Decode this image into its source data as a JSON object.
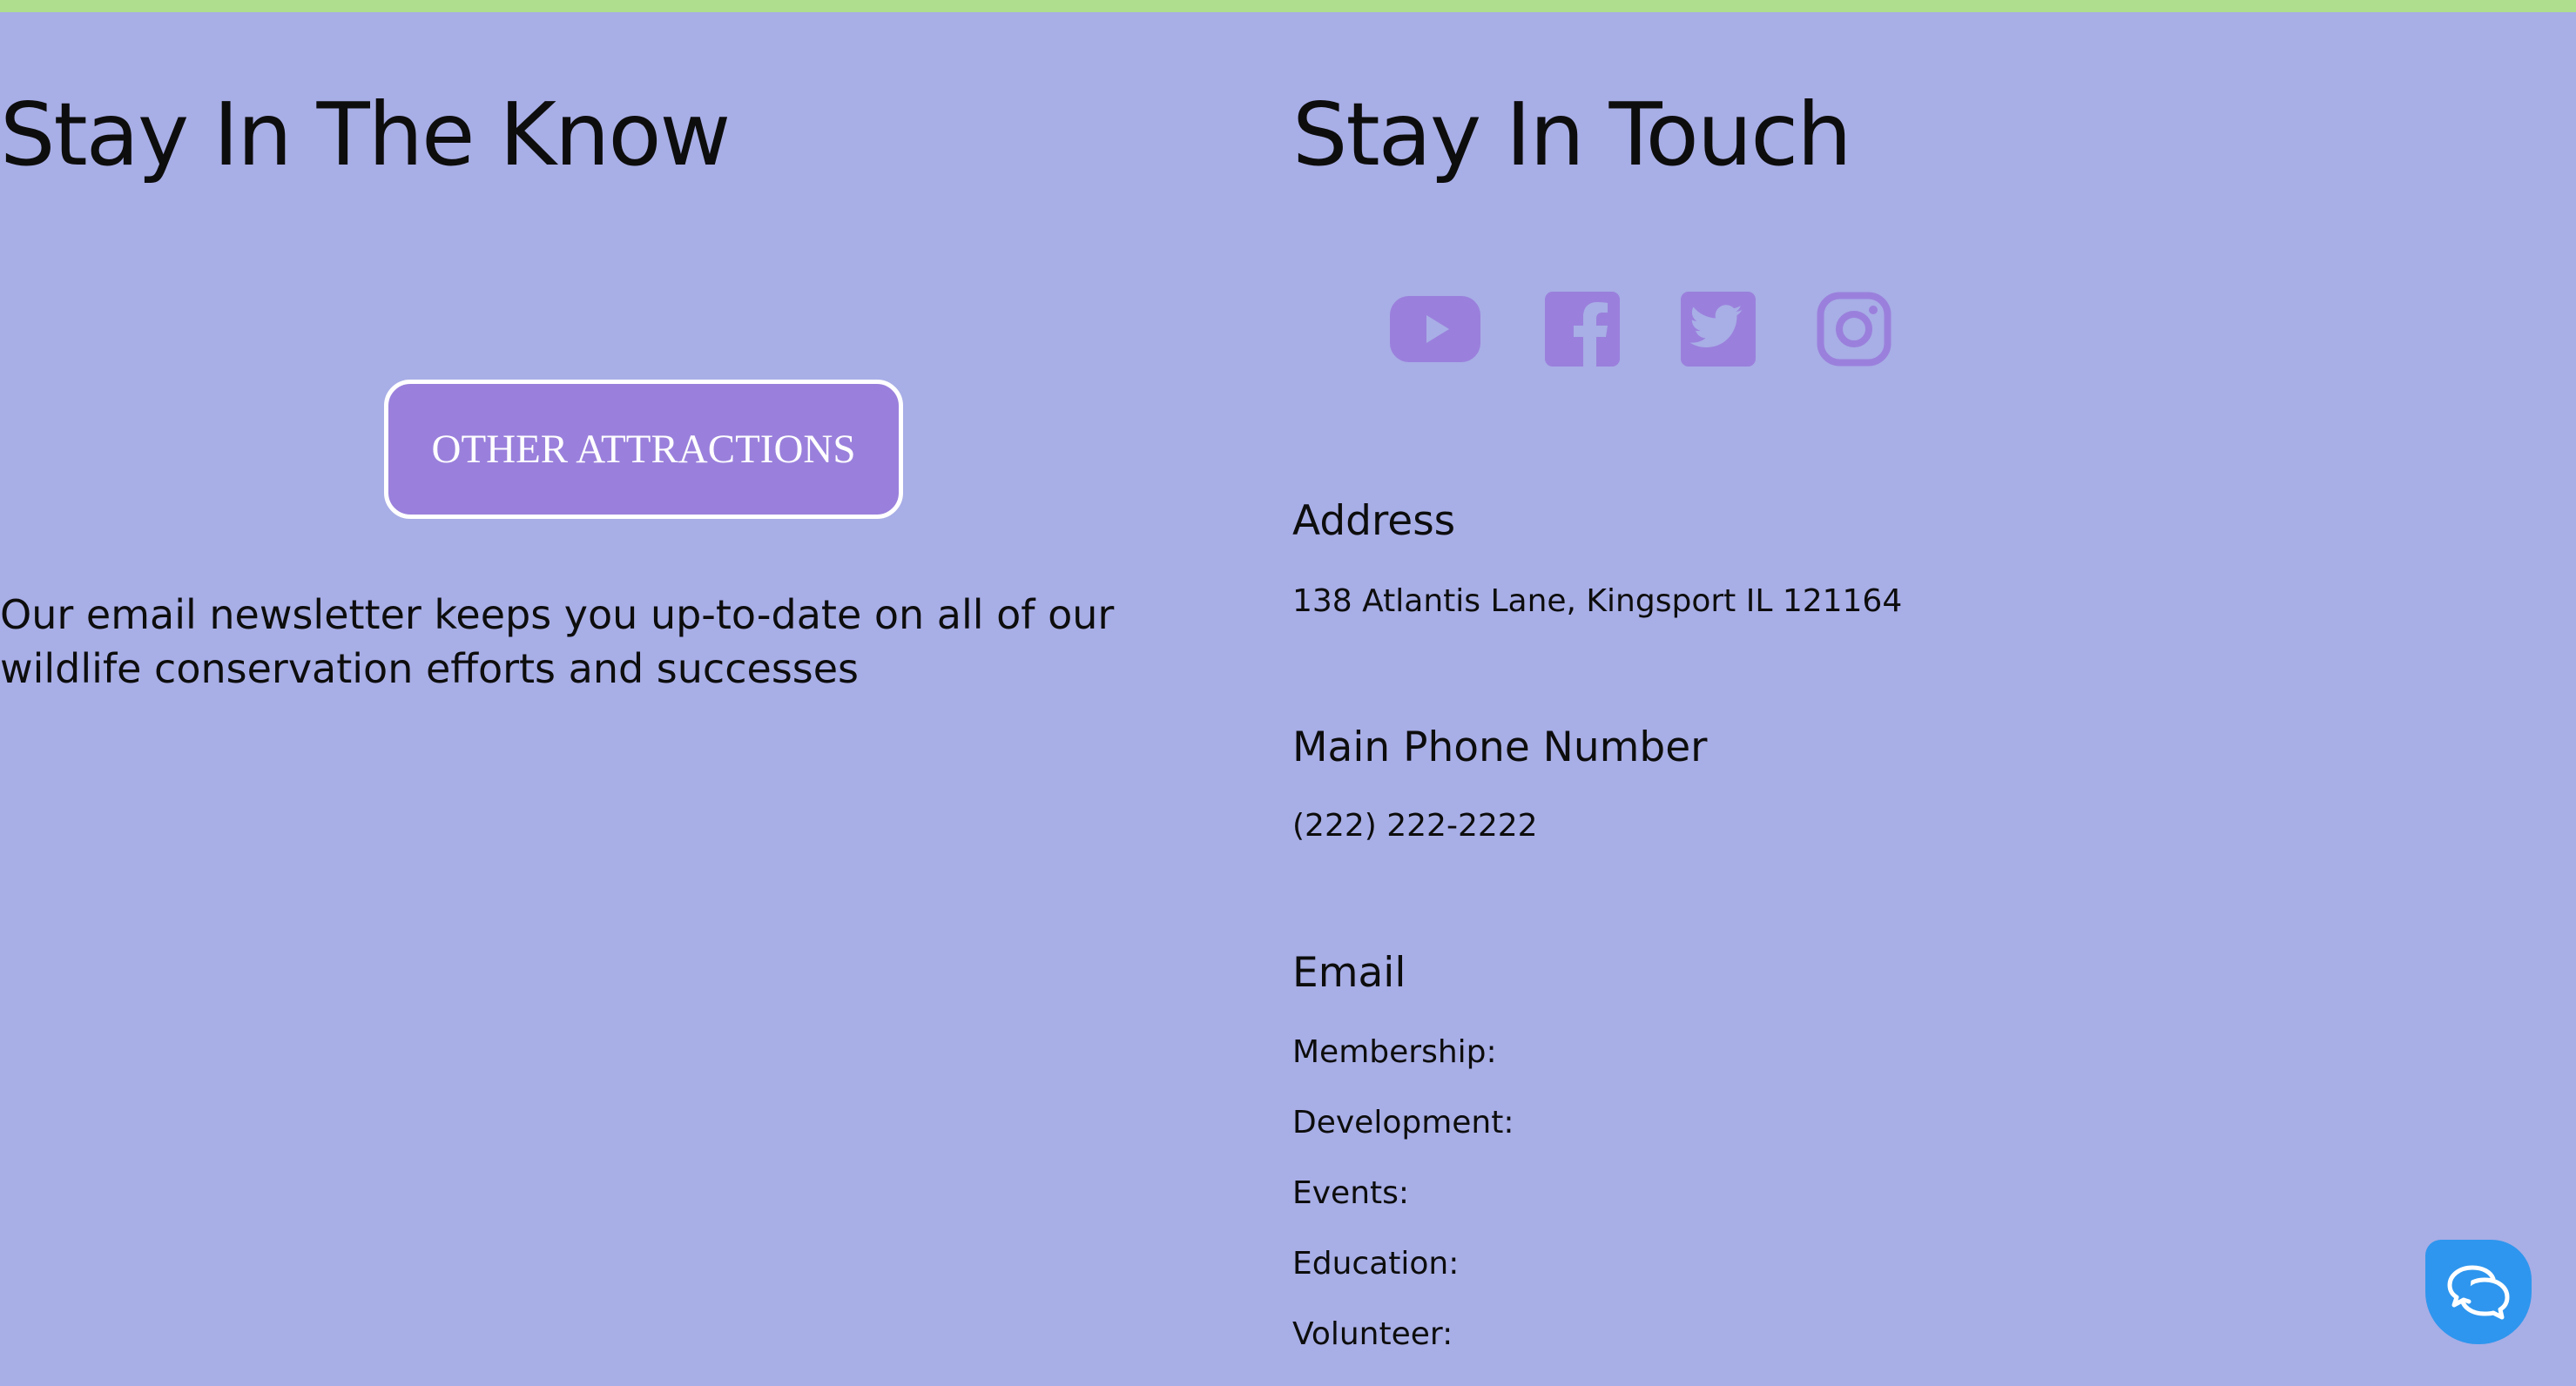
{
  "colors": {
    "background": "#a8aee6",
    "top_bar": "#aede8e",
    "accent_purple": "#9a80dc",
    "chat_blue": "#2e96ee",
    "text": "#0d0d0d"
  },
  "left": {
    "title": "Stay In The Know",
    "button_label": "OTHER ATTRACTIONS",
    "newsletter_text": "Our email newsletter keeps you up-to-date on all of our wildlife conservation efforts and successes"
  },
  "right": {
    "title": "Stay In Touch",
    "social_icons": [
      "youtube-icon",
      "facebook-icon",
      "twitter-icon",
      "instagram-icon"
    ],
    "address_heading": "Address",
    "address": "138 Atlantis Lane, Kingsport IL 121164",
    "phone_heading": "Main Phone Number",
    "phone": "(222) 222-2222",
    "email_heading": "Email",
    "email_items": [
      "Membership:",
      "Development:",
      "Events:",
      "Education:",
      "Volunteer:"
    ]
  },
  "chat": {
    "icon": "chat-bubbles-icon"
  }
}
